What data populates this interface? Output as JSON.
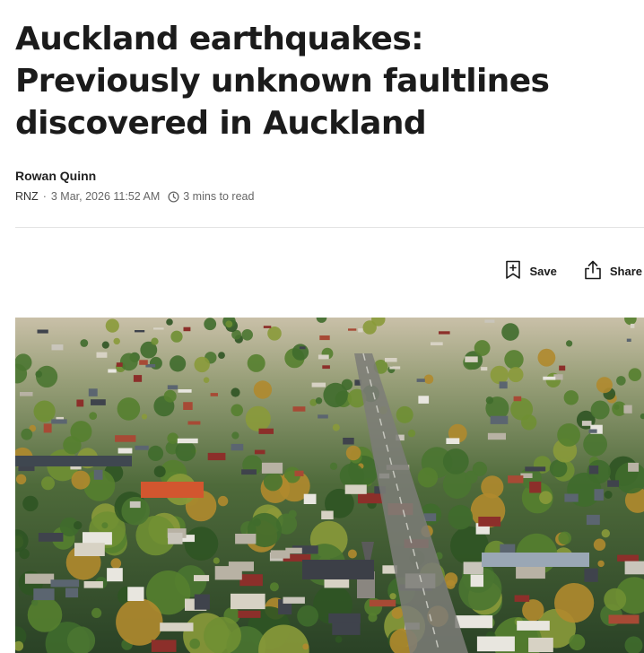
{
  "article": {
    "headline": "Auckland earthquakes: Previously unknown faultlines discovered in Auckland",
    "author": "Rowan Quinn",
    "source": "RNZ",
    "separator": "·",
    "date": "3 Mar, 2026 11:52 AM",
    "read_time": "3 mins to read"
  },
  "actions": {
    "save_label": "Save",
    "share_label": "Share"
  },
  "icons": {
    "save": "bookmark-plus-icon",
    "share": "share-icon",
    "clock": "clock-icon"
  },
  "colors": {
    "headline": "#1b1b1b",
    "meta": "#666666",
    "divider": "#e3e3e3"
  }
}
